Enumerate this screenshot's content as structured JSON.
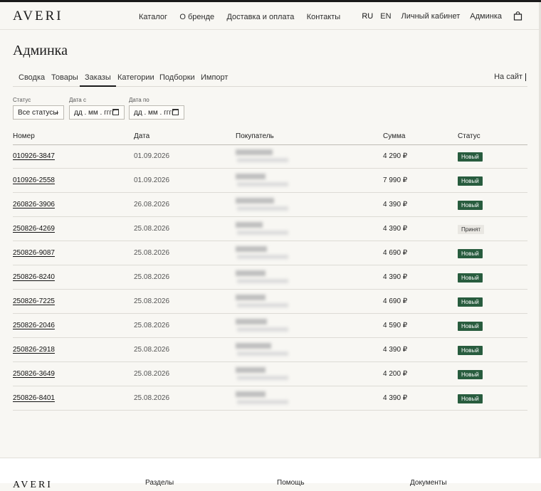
{
  "header": {
    "logo": "AVERI",
    "nav": [
      "Каталог",
      "О бренде",
      "Доставка и оплата",
      "Контакты"
    ],
    "lang_ru": "RU",
    "lang_en": "EN",
    "account": "Личный кабинет",
    "admin": "Админка",
    "cart_icon": "shopping-bag-icon"
  },
  "page": {
    "title": "Админка",
    "tabs": [
      "Сводка",
      "Товары",
      "Заказы",
      "Категории",
      "Подборки",
      "Импорт"
    ],
    "active_tab": "Заказы",
    "to_site": "На сайт"
  },
  "filters": {
    "status_label": "Статус",
    "status_value": "Все статусы",
    "date_from_label": "Дата с",
    "date_from_placeholder": "дд . мм . гггг",
    "date_to_label": "Дата по",
    "date_to_placeholder": "дд . мм . гггг"
  },
  "table": {
    "headers": [
      "Номер",
      "Дата",
      "Покупатель",
      "Сумма",
      "Статус"
    ],
    "rows": [
      {
        "number": "010926-3847",
        "date": "01.09.2026",
        "sum": "4 290 ₽",
        "status": "Новый"
      },
      {
        "number": "010926-2558",
        "date": "01.09.2026",
        "sum": "7 990 ₽",
        "status": "Новый"
      },
      {
        "number": "260826-3906",
        "date": "26.08.2026",
        "sum": "4 390 ₽",
        "status": "Новый"
      },
      {
        "number": "250826-4269",
        "date": "25.08.2026",
        "sum": "4 390 ₽",
        "status": "Принят"
      },
      {
        "number": "250826-9087",
        "date": "25.08.2026",
        "sum": "4 690 ₽",
        "status": "Новый"
      },
      {
        "number": "250826-8240",
        "date": "25.08.2026",
        "sum": "4 390 ₽",
        "status": "Новый"
      },
      {
        "number": "250826-7225",
        "date": "25.08.2026",
        "sum": "4 690 ₽",
        "status": "Новый"
      },
      {
        "number": "250826-2046",
        "date": "25.08.2026",
        "sum": "4 590 ₽",
        "status": "Новый"
      },
      {
        "number": "250826-2918",
        "date": "25.08.2026",
        "sum": "4 390 ₽",
        "status": "Новый"
      },
      {
        "number": "250826-3649",
        "date": "25.08.2026",
        "sum": "4 200 ₽",
        "status": "Новый"
      },
      {
        "number": "250826-8401",
        "date": "25.08.2026",
        "sum": "4 390 ₽",
        "status": "Новый"
      }
    ]
  },
  "footer": {
    "logo": "AVERI",
    "columns": [
      "Разделы",
      "Помощь",
      "Документы"
    ]
  },
  "colors": {
    "accent": "#285c3e",
    "background": "#f8f7f3",
    "text": "#1f1f1f"
  }
}
